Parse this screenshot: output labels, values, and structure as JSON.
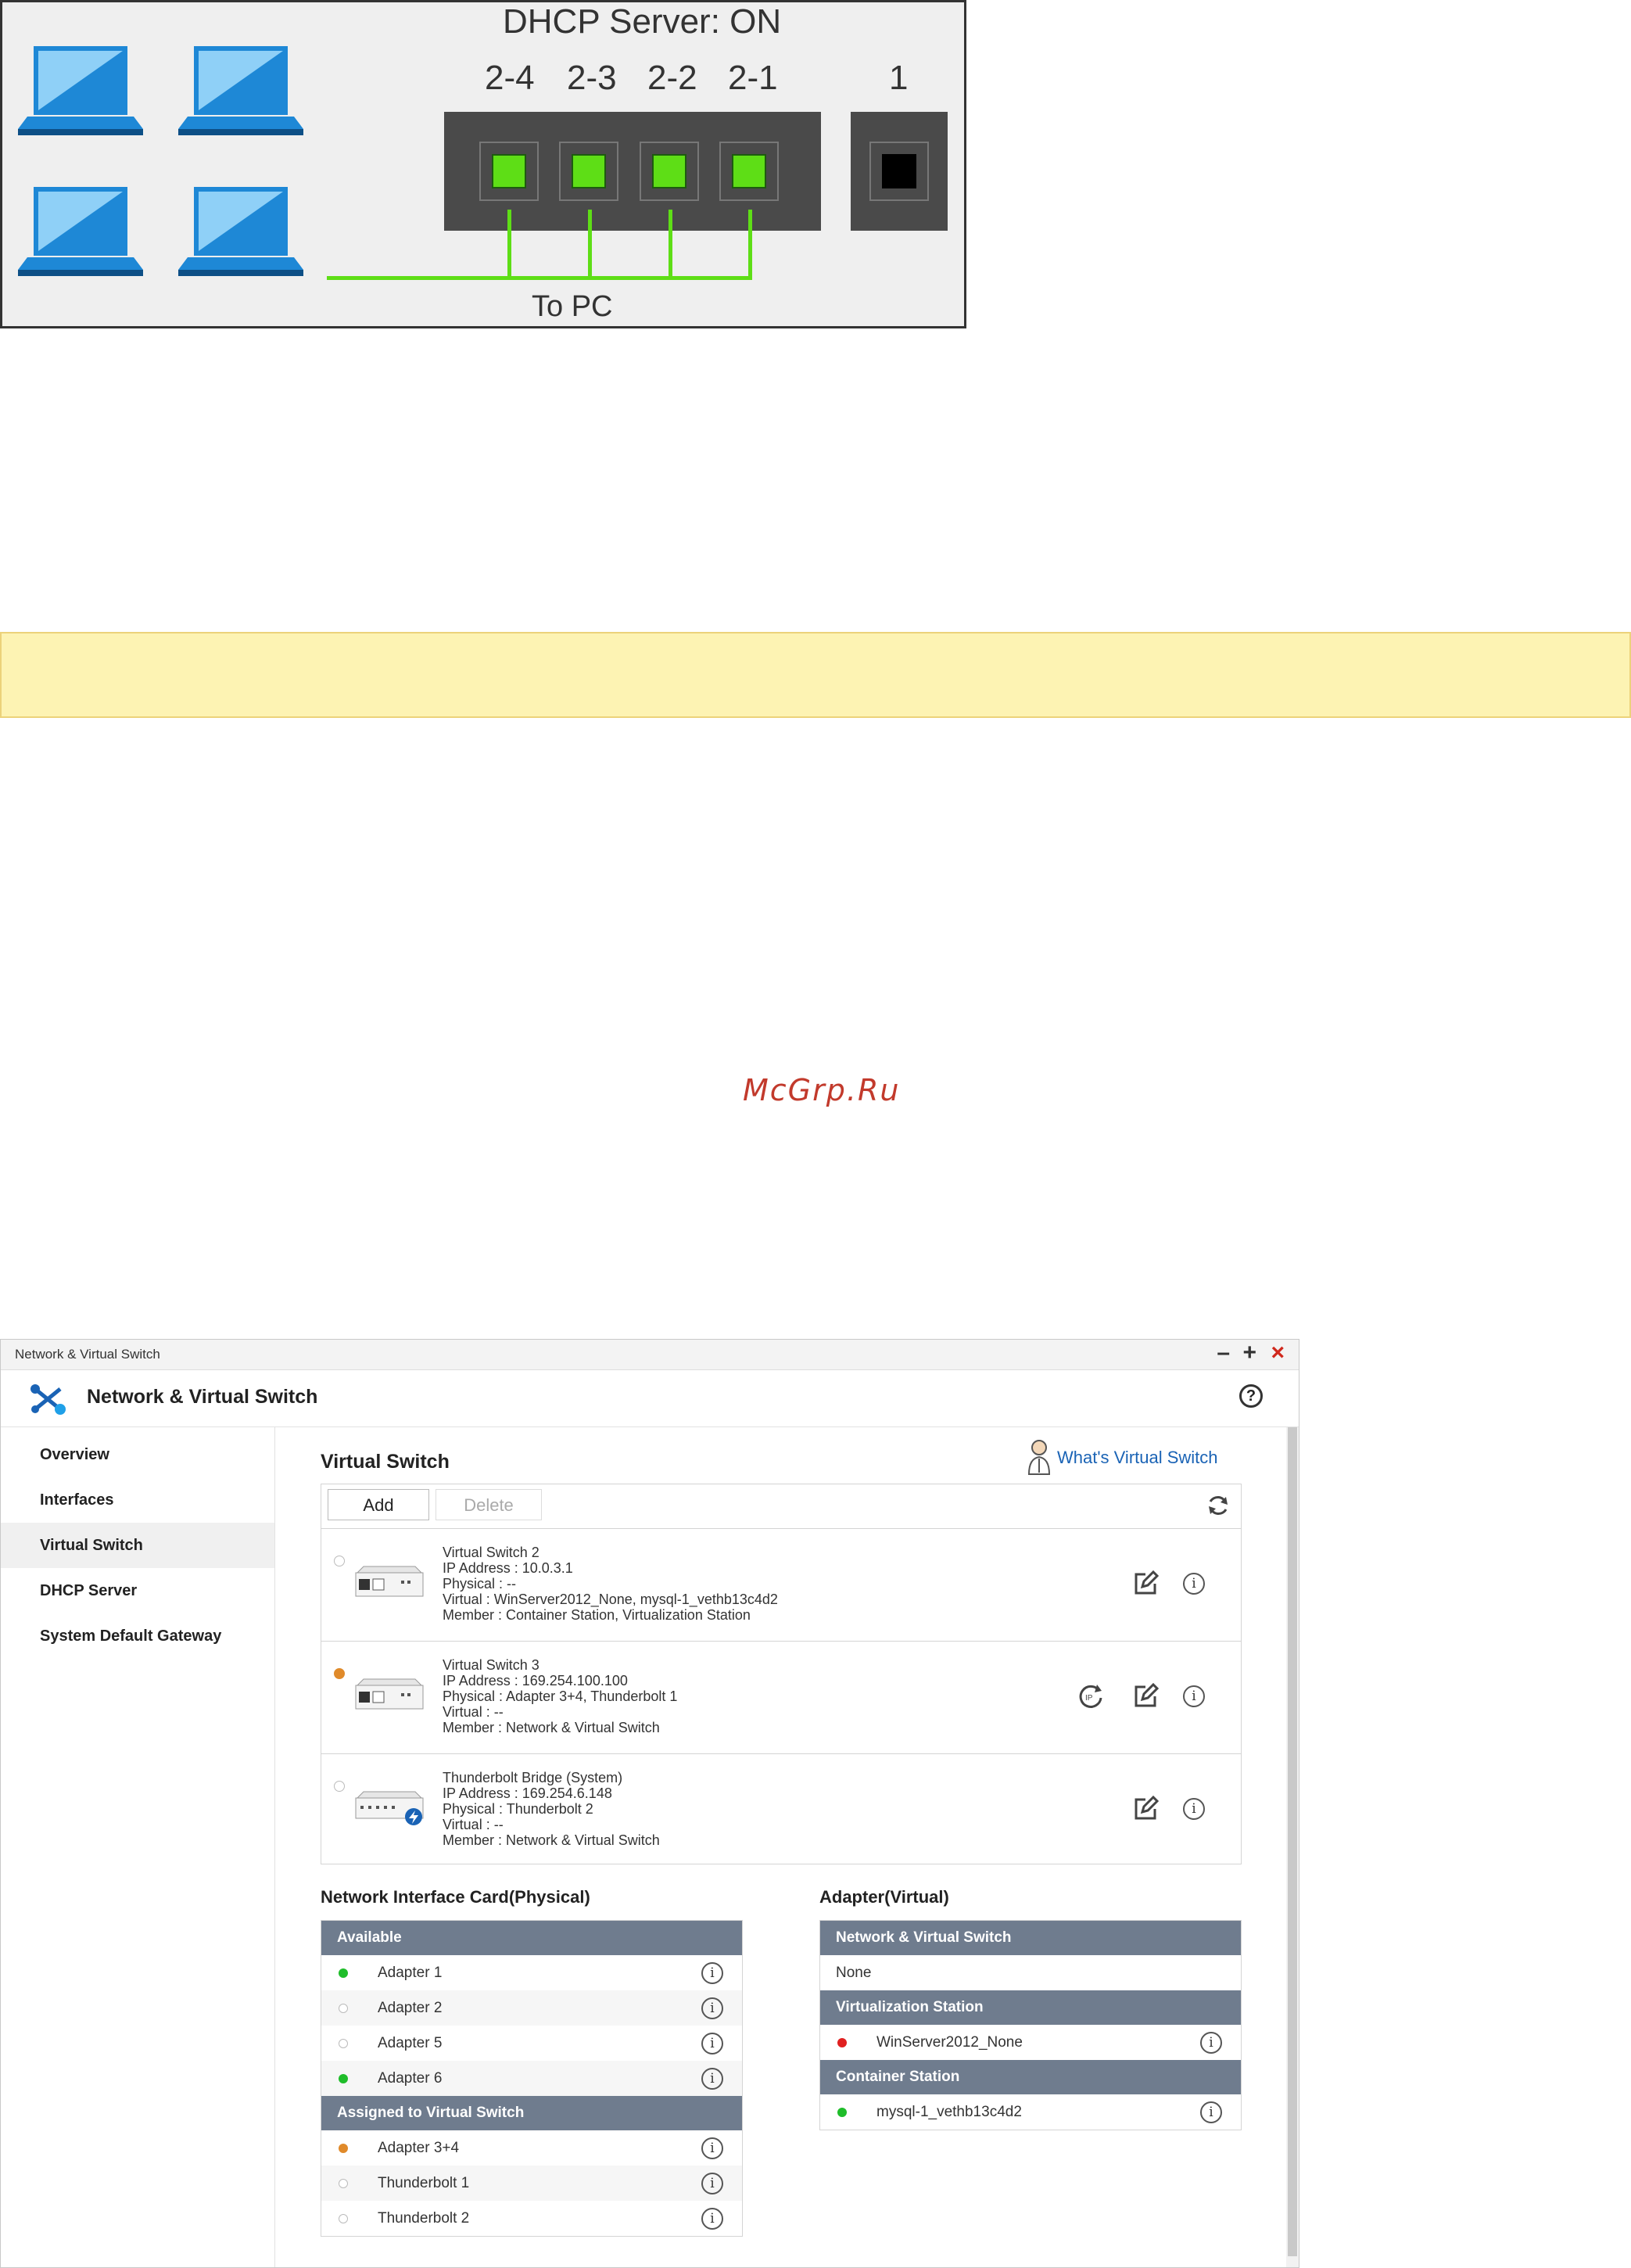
{
  "diagram": {
    "title": "DHCP Server: ON",
    "port_labels": [
      "2-4",
      "2-3",
      "2-2",
      "2-1"
    ],
    "single_port_label": "1",
    "wire_label": "To PC",
    "colors": {
      "active_port": "#5ede16",
      "inactive_port": "#000000",
      "laptop": "#1e88d6"
    }
  },
  "watermark": "McGrp.Ru",
  "window": {
    "titlebar": "Network & Virtual Switch",
    "controls": {
      "minimize": "–",
      "maximize": "+",
      "close": "×"
    },
    "app_name": "Network & Virtual Switch",
    "help_icon": "?",
    "sidebar": [
      {
        "label": "Overview",
        "active": false
      },
      {
        "label": "Interfaces",
        "active": false
      },
      {
        "label": "Virtual Switch",
        "active": true
      },
      {
        "label": "DHCP Server",
        "active": false
      },
      {
        "label": "System Default Gateway",
        "active": false
      }
    ],
    "main": {
      "title": "Virtual Switch",
      "whats_link": "What's Virtual Switch",
      "toolbar": {
        "add": "Add",
        "delete": "Delete"
      },
      "switches": [
        {
          "selected": false,
          "lines": [
            "Virtual Switch 2",
            "IP Address : 10.0.3.1",
            "Physical : --",
            "Virtual : WinServer2012_None, mysql-1_vethb13c4d2",
            "Member : Container Station, Virtualization Station"
          ]
        },
        {
          "selected": true,
          "lines": [
            "Virtual Switch 3",
            "IP Address : 169.254.100.100",
            "Physical : Adapter 3+4, Thunderbolt 1",
            "Virtual : --",
            "Member : Network & Virtual Switch"
          ]
        },
        {
          "selected": false,
          "lines": [
            "Thunderbolt Bridge (System)",
            "IP Address : 169.254.6.148",
            "Physical : Thunderbolt 2",
            "Virtual : --",
            "Member : Network & Virtual Switch"
          ]
        }
      ],
      "physical": {
        "title": "Network Interface Card(Physical)",
        "available_header": "Available",
        "available": [
          {
            "label": "Adapter 1",
            "status": "green"
          },
          {
            "label": "Adapter 2",
            "status": "empty"
          },
          {
            "label": "Adapter 5",
            "status": "empty"
          },
          {
            "label": "Adapter 6",
            "status": "green"
          }
        ],
        "assigned_header": "Assigned to Virtual Switch",
        "assigned": [
          {
            "label": "Adapter 3+4",
            "status": "orange"
          },
          {
            "label": "Thunderbolt 1",
            "status": "empty"
          },
          {
            "label": "Thunderbolt 2",
            "status": "empty"
          }
        ]
      },
      "virtual": {
        "title": "Adapter(Virtual)",
        "groups": [
          {
            "header": "Network & Virtual Switch",
            "none_label": "None"
          },
          {
            "header": "Virtualization Station",
            "items": [
              {
                "label": "WinServer2012_None",
                "status": "red"
              }
            ]
          },
          {
            "header": "Container Station",
            "items": [
              {
                "label": "mysql-1_vethb13c4d2",
                "status": "green"
              }
            ]
          }
        ]
      }
    }
  }
}
